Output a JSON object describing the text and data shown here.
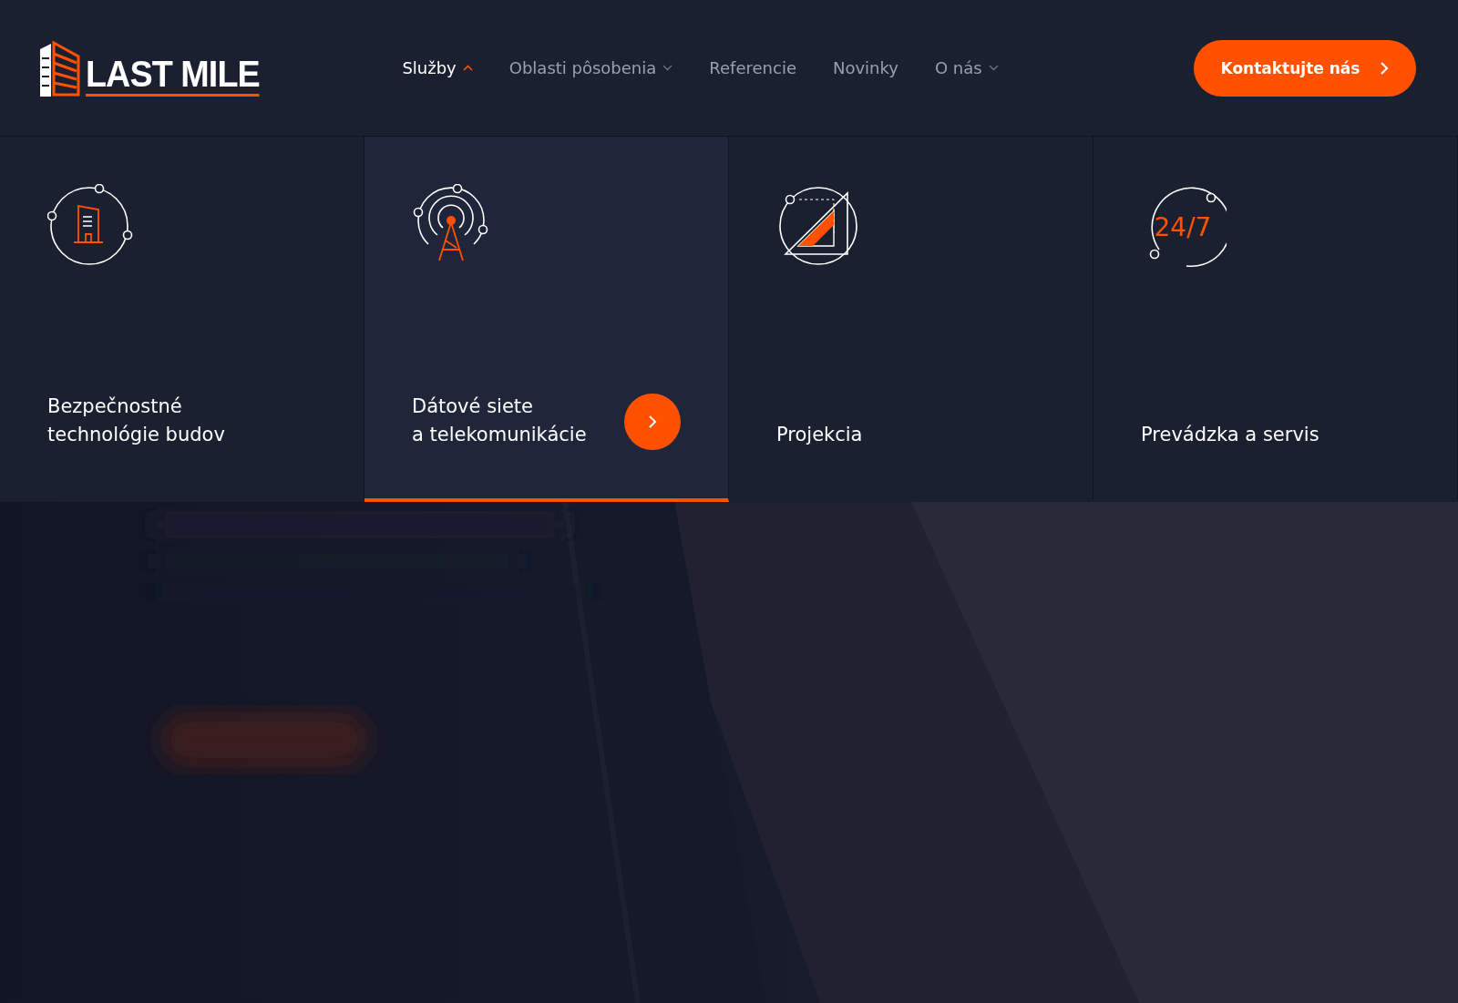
{
  "header": {
    "logo": "LAST MILE",
    "nav": [
      {
        "label": "Služby",
        "dropdown": true,
        "selected": true
      },
      {
        "label": "Oblasti pôsobenia",
        "dropdown": true,
        "selected": false
      },
      {
        "label": "Referencie",
        "dropdown": false,
        "selected": false
      },
      {
        "label": "Novinky",
        "dropdown": false,
        "selected": false
      },
      {
        "label": "O nás",
        "dropdown": true,
        "selected": false
      }
    ],
    "cta": "Kontaktujte nás"
  },
  "services": [
    {
      "title": "Bezpečnostné\ntechnológie budov",
      "kind": "building",
      "selected": false
    },
    {
      "title": "Dátové siete\na telekomunikácie",
      "kind": "tower",
      "selected": true
    },
    {
      "title": "Projekcia",
      "kind": "drafting",
      "selected": false
    },
    {
      "title": "Prevádzka a servis",
      "kind": "clock",
      "icon_text": "24/7",
      "selected": false
    }
  ]
}
